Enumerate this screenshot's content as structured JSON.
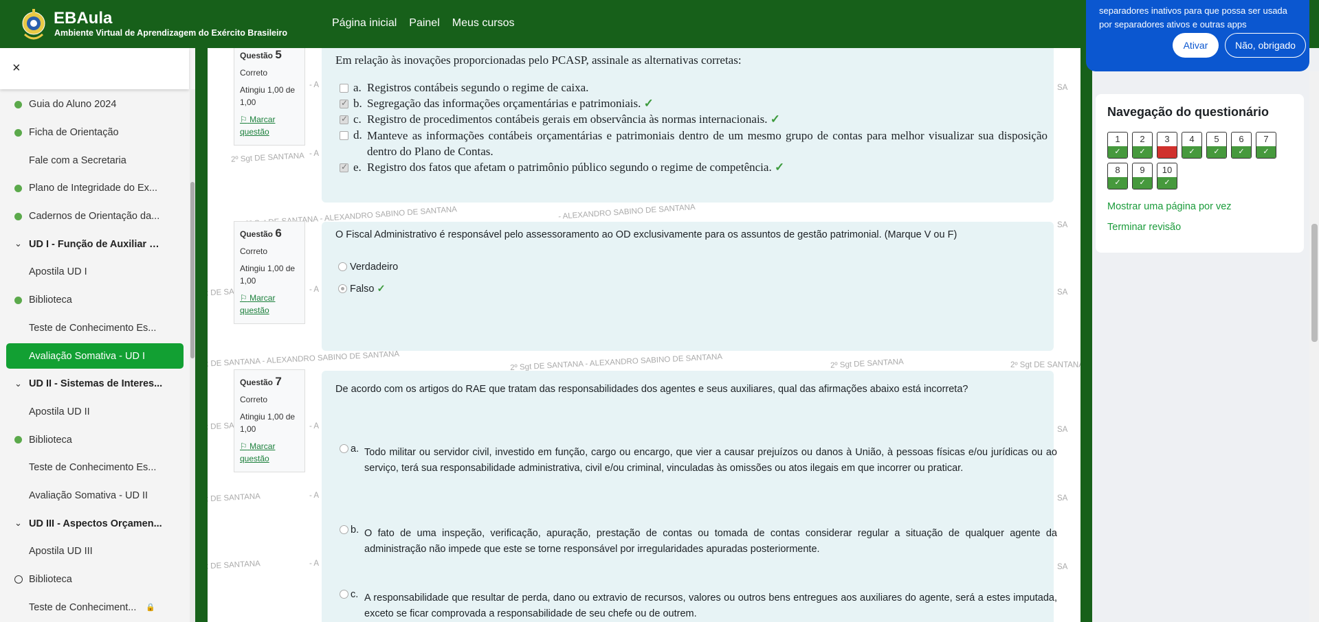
{
  "brand": {
    "title": "EBAula",
    "subtitle": "Ambiente Virtual de Aprendizagem do Exército Brasileiro"
  },
  "nav": {
    "links": [
      "Página inicial",
      "Painel",
      "Meus cursos"
    ]
  },
  "drawer": {
    "close": "×",
    "items": [
      {
        "label": "Guia do Aluno 2024",
        "marker": "dot"
      },
      {
        "label": "Ficha de Orientação",
        "marker": "dot"
      },
      {
        "label": "Fale com a Secretaria",
        "marker": "none"
      },
      {
        "label": "Plano de Integridade do Ex...",
        "marker": "dot"
      },
      {
        "label": "Cadernos de Orientação da...",
        "marker": "dot"
      },
      {
        "label": "UD I - Função de Auxiliar d...",
        "marker": "section"
      },
      {
        "label": "Apostila UD I",
        "marker": "none"
      },
      {
        "label": "Biblioteca",
        "marker": "dot"
      },
      {
        "label": "Teste de Conhecimento Es...",
        "marker": "none"
      },
      {
        "label": "Avaliação Somativa - UD I",
        "marker": "active"
      },
      {
        "label": "UD II - Sistemas de Interes...",
        "marker": "section"
      },
      {
        "label": "Apostila UD II",
        "marker": "none"
      },
      {
        "label": "Biblioteca",
        "marker": "dot"
      },
      {
        "label": "Teste de Conhecimento Es...",
        "marker": "none"
      },
      {
        "label": "Avaliação Somativa - UD II",
        "marker": "none"
      },
      {
        "label": "UD III - Aspectos Orçamen...",
        "marker": "section"
      },
      {
        "label": "Apostila UD III",
        "marker": "none"
      },
      {
        "label": "Biblioteca",
        "marker": "circle"
      },
      {
        "label": "Teste de Conheciment...",
        "marker": "lock"
      }
    ]
  },
  "watermarks": {
    "short": "2º Sgt DE SANTANA",
    "long": "2º Sgt DE SANTANA  - ALEXANDRO SABINO DE SANTANA",
    "name": "- ALEXANDRO SABINO DE SANTANA",
    "fragA": "- A",
    "fragSA": "SA"
  },
  "questions": {
    "q5": {
      "label": "Questão",
      "number": "5",
      "status": "Correto",
      "score": "Atingiu 1,00 de 1,00",
      "flag": "Marcar questão",
      "text": "Em relação às inovações proporcionadas pelo PCASP, assinale as alternativas corretas:",
      "options": [
        {
          "letter": "a.",
          "text": "Registros contábeis segundo o regime de caixa.",
          "checked": false,
          "correct": false
        },
        {
          "letter": "b.",
          "text": "Segregação das informações orçamentárias e patrimoniais.",
          "checked": true,
          "correct": true
        },
        {
          "letter": "c.",
          "text": "Registro de procedimentos contábeis gerais em observância às normas internacionais.",
          "checked": true,
          "correct": true
        },
        {
          "letter": "d.",
          "text": "Manteve as informações contábeis orçamentárias e patrimoniais dentro de um mesmo grupo de contas para melhor visualizar sua disposição dentro do Plano de Contas.",
          "checked": false,
          "correct": false
        },
        {
          "letter": "e.",
          "text": "Registro dos fatos que afetam o patrimônio público segundo o regime de competência.",
          "checked": true,
          "correct": true
        }
      ]
    },
    "q6": {
      "label": "Questão",
      "number": "6",
      "status": "Correto",
      "score": "Atingiu 1,00 de 1,00",
      "flag": "Marcar questão",
      "text": "O Fiscal Administrativo é responsável pelo assessoramento ao OD exclusivamente para os assuntos de gestão patrimonial. (Marque V ou F)",
      "options": [
        {
          "text": "Verdadeiro",
          "checked": false,
          "correct": false
        },
        {
          "text": "Falso",
          "checked": true,
          "correct": true
        }
      ]
    },
    "q7": {
      "label": "Questão",
      "number": "7",
      "status": "Correto",
      "score": "Atingiu 1,00 de 1,00",
      "flag": "Marcar questão",
      "text": "De acordo com os artigos do RAE que tratam das responsabilidades dos agentes e seus auxiliares, qual das afirmações abaixo está incorreta?",
      "options": [
        {
          "letter": "a.",
          "text": "Todo militar ou servidor civil, investido em função, cargo ou encargo, que vier a causar prejuízos ou danos à União, à pessoas físicas e/ou jurídicas ou ao serviço, terá sua responsabilidade administrativa, civil e/ou criminal, vinculadas às omissões ou atos ilegais em que incorrer ou praticar."
        },
        {
          "letter": "b.",
          "text": "O fato de uma inspeção, verificação, apuração, prestação de contas ou tomada de contas considerar regular a situação de qualquer agente da administração não impede que este se torne responsável por irregularidades apuradas posteriormente."
        },
        {
          "letter": "c.",
          "text": "A responsabilidade que resultar de perda, dano ou extravio de recursos, valores ou outros bens entregues aos auxiliares do agente, será a estes imputada, exceto se ficar comprovada a responsabilidade de seu chefe ou de outrem."
        }
      ]
    }
  },
  "popup": {
    "text": "separadores inativos para que possa ser usada por separadores ativos e outras apps",
    "accept": "Ativar",
    "decline": "Não, obrigado"
  },
  "quiz_nav": {
    "title": "Navegação do questionário",
    "buttons": [
      {
        "n": "1",
        "state": "correct"
      },
      {
        "n": "2",
        "state": "correct"
      },
      {
        "n": "3",
        "state": "incorrect"
      },
      {
        "n": "4",
        "state": "correct"
      },
      {
        "n": "5",
        "state": "correct"
      },
      {
        "n": "6",
        "state": "correct"
      },
      {
        "n": "7",
        "state": "correct"
      },
      {
        "n": "8",
        "state": "correct"
      },
      {
        "n": "9",
        "state": "correct"
      },
      {
        "n": "10",
        "state": "correct"
      }
    ],
    "show_one_page": "Mostrar uma página por vez",
    "finish_review": "Terminar revisão"
  },
  "colors": {
    "brand_green": "#17601a",
    "active_green": "#12a033",
    "correct": "#46993d",
    "incorrect": "#d0312d",
    "popup_blue": "#0b57d0"
  }
}
